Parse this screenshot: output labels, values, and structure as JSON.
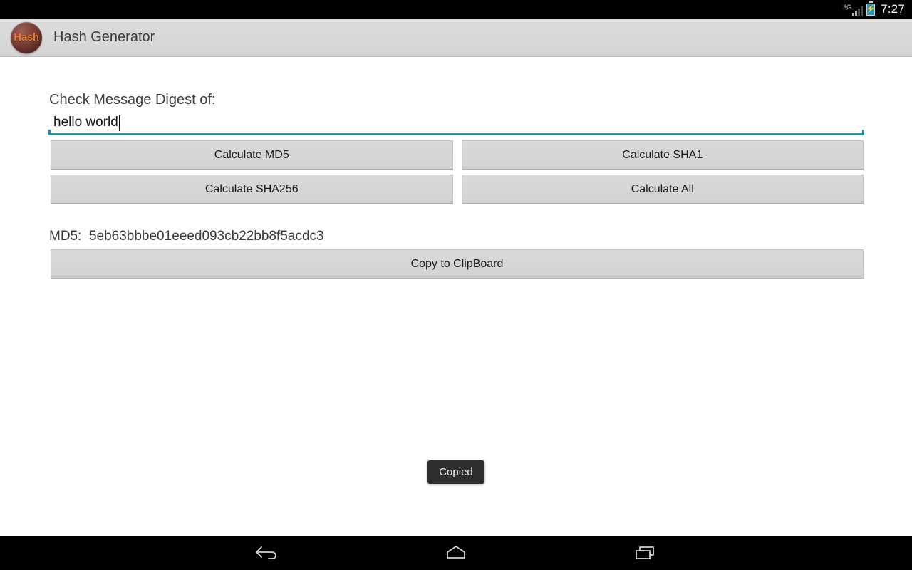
{
  "status_bar": {
    "network_label": "3G",
    "time": "7:27",
    "icons": {
      "signal": "signal-bars-icon",
      "battery": "battery-charging-icon"
    }
  },
  "action_bar": {
    "app_icon_glyph": "Hash",
    "title": "Hash Generator"
  },
  "main": {
    "prompt_label": "Check Message Digest of:",
    "input": {
      "value": "hello world",
      "placeholder": "",
      "accent_color": "#1f94ad"
    },
    "buttons": [
      {
        "label": "Calculate MD5"
      },
      {
        "label": "Calculate SHA1"
      },
      {
        "label": "Calculate SHA256"
      },
      {
        "label": "Calculate All"
      }
    ],
    "result": {
      "label": "MD5:",
      "value": "5eb63bbbe01eeed093cb22bb8f5acdc3",
      "full_text": "MD5:  5eb63bbbe01eeed093cb22bb8f5acdc3"
    },
    "copy_button": {
      "label": "Copy to ClipBoard"
    }
  },
  "toast": {
    "message": "Copied"
  },
  "nav_bar": {
    "back": "back-icon",
    "home": "home-icon",
    "recents": "recents-icon"
  },
  "colors": {
    "accent": "#1f94ad",
    "action_bar_bg": "#d6d6d6",
    "button_bg": "#d4d4d4",
    "toast_bg": "#2e2e2e",
    "icon_orange": "#e8762c"
  }
}
